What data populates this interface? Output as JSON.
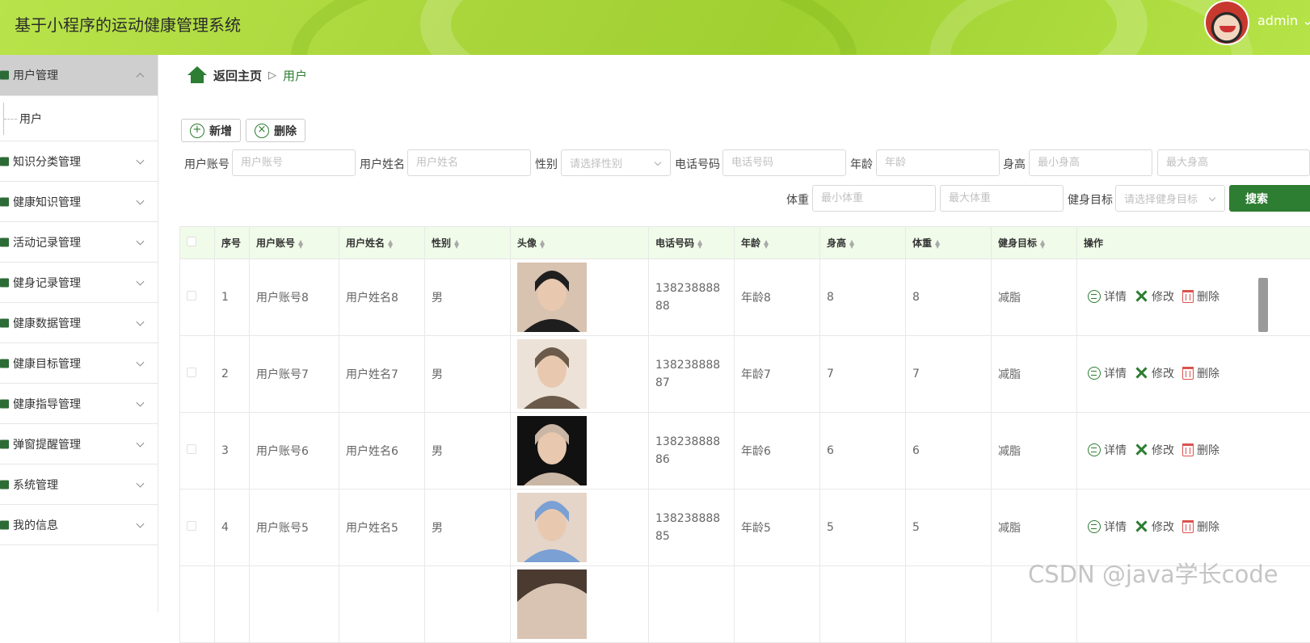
{
  "header": {
    "title": "基于小程序的运动健康管理系统",
    "user": "admin"
  },
  "sidebar": {
    "items": [
      {
        "label": "用户管理",
        "active": true,
        "children": [
          "用户"
        ]
      },
      {
        "label": "知识分类管理"
      },
      {
        "label": "健康知识管理"
      },
      {
        "label": "活动记录管理"
      },
      {
        "label": "健身记录管理"
      },
      {
        "label": "健康数据管理"
      },
      {
        "label": "健康目标管理"
      },
      {
        "label": "健康指导管理"
      },
      {
        "label": "弹窗提醒管理"
      },
      {
        "label": "系统管理"
      },
      {
        "label": "我的信息"
      }
    ]
  },
  "breadcrumb": {
    "home": "返回主页",
    "sep": "▷",
    "current": "用户"
  },
  "toolbar": {
    "add": "新增",
    "delete": "删除"
  },
  "filters": {
    "account_label": "用户账号",
    "account_ph": "用户账号",
    "name_label": "用户姓名",
    "name_ph": "用户姓名",
    "gender_label": "性别",
    "gender_ph": "请选择性别",
    "phone_label": "电话号码",
    "phone_ph": "电话号码",
    "age_label": "年龄",
    "age_ph": "年龄",
    "height_label": "身高",
    "height_min_ph": "最小身高",
    "height_max_ph": "最大身高",
    "weight_label": "体重",
    "weight_min_ph": "最小体重",
    "weight_max_ph": "最大体重",
    "goal_label": "健身目标",
    "goal_ph": "请选择健身目标",
    "search": "搜索"
  },
  "table": {
    "headers": [
      "序号",
      "用户账号",
      "用户姓名",
      "性别",
      "头像",
      "电话号码",
      "年龄",
      "身高",
      "体重",
      "健身目标",
      "操作"
    ],
    "rows": [
      {
        "no": "1",
        "account": "用户账号8",
        "name": "用户姓名8",
        "gender": "男",
        "phone": "13823888888",
        "age": "年龄8",
        "height": "8",
        "weight": "8",
        "goal": "减脂"
      },
      {
        "no": "2",
        "account": "用户账号7",
        "name": "用户姓名7",
        "gender": "男",
        "phone": "13823888887",
        "age": "年龄7",
        "height": "7",
        "weight": "7",
        "goal": "减脂"
      },
      {
        "no": "3",
        "account": "用户账号6",
        "name": "用户姓名6",
        "gender": "男",
        "phone": "13823888886",
        "age": "年龄6",
        "height": "6",
        "weight": "6",
        "goal": "减脂"
      },
      {
        "no": "4",
        "account": "用户账号5",
        "name": "用户姓名5",
        "gender": "男",
        "phone": "13823888885",
        "age": "年龄5",
        "height": "5",
        "weight": "5",
        "goal": "减脂"
      }
    ],
    "actions": {
      "detail": "详情",
      "edit": "修改",
      "delete": "删除"
    }
  },
  "watermark": "CSDN @java学长code"
}
